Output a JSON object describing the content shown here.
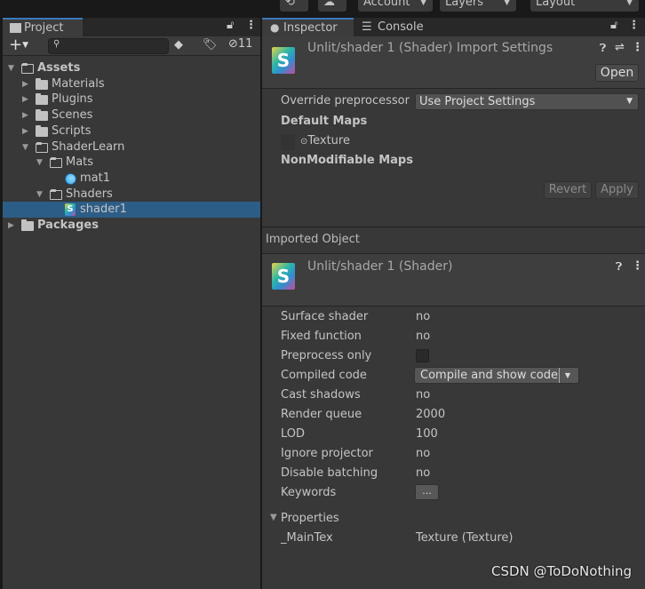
{
  "toolbar": {
    "collab_icon": "collab-icon",
    "cloud_icon": "cloud-icon",
    "account": "Account",
    "layers": "Layers",
    "layout": "Layout"
  },
  "project": {
    "tab": "Project",
    "hidden_count": "11",
    "search_placeholder": "",
    "tree": [
      {
        "label": "Assets",
        "depth": 0,
        "expanded": true,
        "bold": true,
        "icon": "folder-open"
      },
      {
        "label": "Materials",
        "depth": 1,
        "expanded": false,
        "icon": "folder"
      },
      {
        "label": "Plugins",
        "depth": 1,
        "expanded": false,
        "icon": "folder"
      },
      {
        "label": "Scenes",
        "depth": 1,
        "expanded": false,
        "icon": "folder"
      },
      {
        "label": "Scripts",
        "depth": 1,
        "expanded": false,
        "icon": "folder"
      },
      {
        "label": "ShaderLearn",
        "depth": 1,
        "expanded": true,
        "icon": "folder-open"
      },
      {
        "label": "Mats",
        "depth": 2,
        "expanded": true,
        "icon": "folder-open"
      },
      {
        "label": "mat1",
        "depth": 3,
        "icon": "material"
      },
      {
        "label": "Shaders",
        "depth": 2,
        "expanded": true,
        "icon": "folder-open"
      },
      {
        "label": "shader1",
        "depth": 3,
        "icon": "shader",
        "selected": true
      },
      {
        "label": "Packages",
        "depth": 0,
        "expanded": false,
        "bold": true,
        "icon": "folder"
      }
    ]
  },
  "inspector": {
    "tab": "Inspector",
    "console_tab": "Console",
    "import_title": "Unlit/shader 1 (Shader) Import Settings",
    "open": "Open",
    "override_label": "Override preprocessor",
    "override_value": "Use Project Settings",
    "default_maps": "Default Maps",
    "texture_label": "Texture",
    "nonmodifiable": "NonModifiable Maps",
    "revert": "Revert",
    "apply": "Apply",
    "imported_object": "Imported Object",
    "shader_title": "Unlit/shader 1 (Shader)",
    "props": [
      {
        "label": "Surface shader",
        "value": "no"
      },
      {
        "label": "Fixed function",
        "value": "no"
      },
      {
        "label": "Preprocess only",
        "type": "checkbox",
        "checked": false
      },
      {
        "label": "Compiled code",
        "type": "dropdown",
        "value": "Compile and show code"
      },
      {
        "label": "Cast shadows",
        "value": "no"
      },
      {
        "label": "Render queue",
        "value": "2000"
      },
      {
        "label": "LOD",
        "value": "100"
      },
      {
        "label": "Ignore projector",
        "value": "no"
      },
      {
        "label": "Disable batching",
        "value": "no"
      },
      {
        "label": "Keywords",
        "type": "button",
        "value": "..."
      }
    ],
    "properties_label": "Properties",
    "maintex_label": "_MainTex",
    "maintex_value": "Texture (Texture)"
  },
  "watermark": "CSDN @ToDoNothing",
  "colors": {
    "selection": "#2c5d87",
    "panel": "#383838",
    "accent_tab": "#3a79bb"
  }
}
